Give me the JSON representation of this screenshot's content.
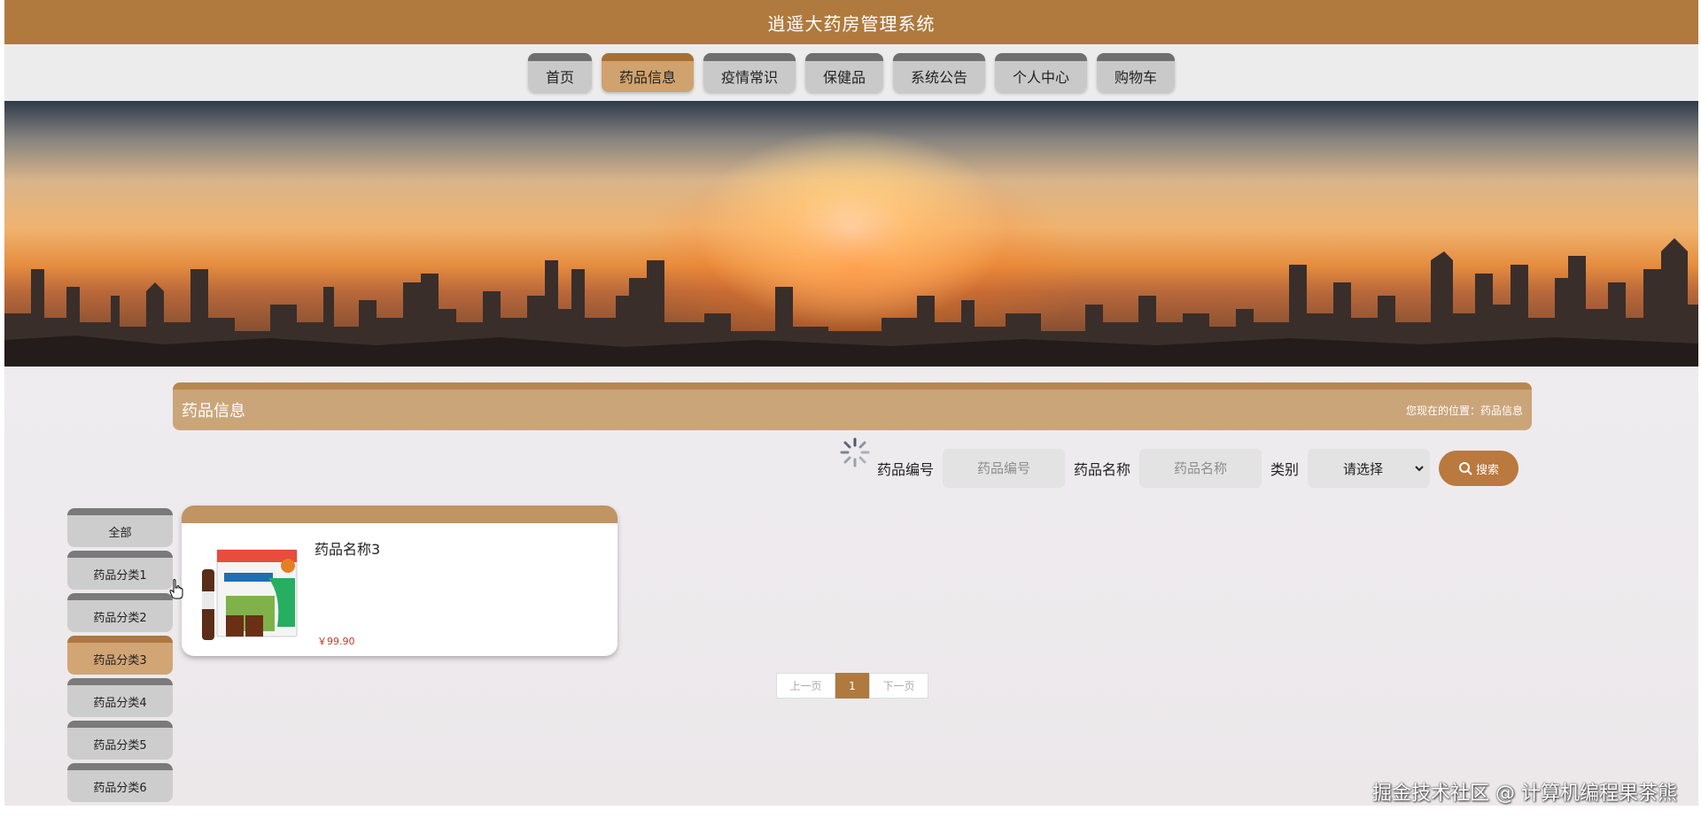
{
  "header": {
    "title": "逍遥大药房管理系统"
  },
  "nav": {
    "items": [
      {
        "label": "首页",
        "active": false
      },
      {
        "label": "药品信息",
        "active": true
      },
      {
        "label": "疫情常识",
        "active": false
      },
      {
        "label": "保健品",
        "active": false
      },
      {
        "label": "系统公告",
        "active": false
      },
      {
        "label": "个人中心",
        "active": false
      },
      {
        "label": "购物车",
        "active": false
      }
    ]
  },
  "section": {
    "title": "药品信息",
    "breadcrumb": "您现在的位置：药品信息"
  },
  "search": {
    "code_label": "药品编号",
    "code_placeholder": "药品编号",
    "name_label": "药品名称",
    "name_placeholder": "药品名称",
    "category_label": "类别",
    "category_value": "请选择",
    "button_label": "搜索"
  },
  "sidebar": {
    "items": [
      {
        "label": "全部",
        "active": false
      },
      {
        "label": "药品分类1",
        "active": false
      },
      {
        "label": "药品分类2",
        "active": false
      },
      {
        "label": "药品分类3",
        "active": true
      },
      {
        "label": "药品分类4",
        "active": false
      },
      {
        "label": "药品分类5",
        "active": false
      },
      {
        "label": "药品分类6",
        "active": false
      }
    ]
  },
  "products": [
    {
      "name": "药品名称3",
      "price": "￥99.90",
      "image_icon": "medicine-box-image"
    }
  ],
  "pagination": {
    "prev": "上一页",
    "current": "1",
    "next": "下一页"
  },
  "watermark": "掘金技术社区 @ 计算机编程果茶熊",
  "colors": {
    "primary": "#b07a3e",
    "active_tab": "#d0a26d",
    "inactive_tab": "#c9c9c9",
    "price": "#c0392b"
  }
}
